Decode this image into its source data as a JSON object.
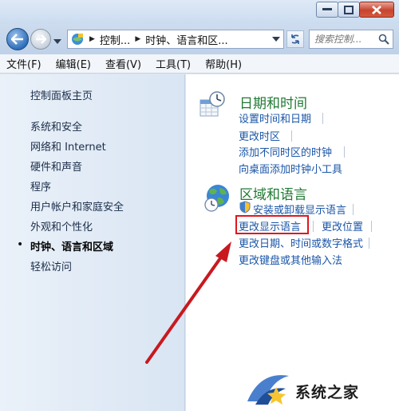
{
  "address": {
    "crumbs": [
      "控制...",
      "时钟、语言和区..."
    ],
    "search_placeholder": "搜索控制..."
  },
  "menu": [
    "文件(F)",
    "编辑(E)",
    "查看(V)",
    "工具(T)",
    "帮助(H)"
  ],
  "left": {
    "home": "控制面板主页",
    "items": [
      "系统和安全",
      "网络和 Internet",
      "硬件和声音",
      "程序",
      "用户帐户和家庭安全",
      "外观和个性化",
      "时钟、语言和区域",
      "轻松访问"
    ],
    "current_index": 6
  },
  "right": {
    "datetime": {
      "title": "日期和时间",
      "links": [
        "设置时间和日期",
        "更改时区",
        "添加不同时区的时钟",
        "向桌面添加时钟小工具"
      ]
    },
    "region": {
      "title": "区域和语言",
      "links": [
        "安装或卸载显示语言",
        "更改显示语言",
        "更改位置",
        "更改日期、时间或数字格式",
        "更改键盘或其他输入法"
      ]
    }
  },
  "watermark": "系统之家",
  "colors": {
    "category_title": "#1f7a33",
    "link": "#1b56a8",
    "highlight_box": "#e0161c",
    "arrow": "#c8191f"
  }
}
